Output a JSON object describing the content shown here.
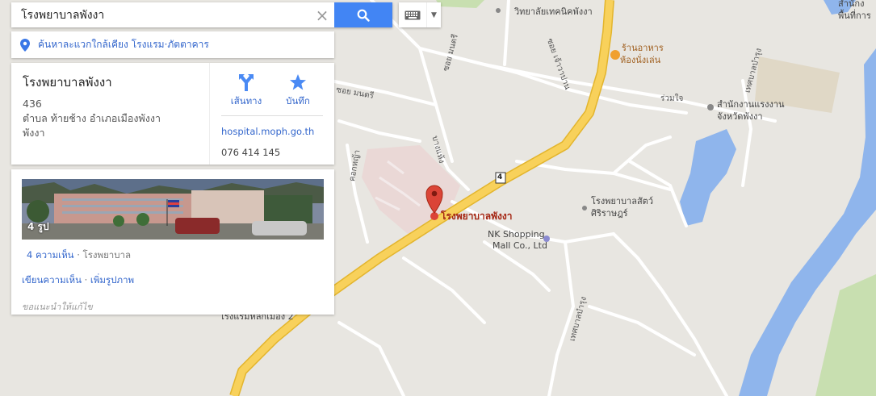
{
  "search": {
    "value": "โรงพยาบาลพังงา"
  },
  "nearby": {
    "text": "ค้นหาละแวกใกล้เคียง โรงแรม·ภัตตาคาร"
  },
  "place": {
    "name": "โรงพยาบาลพังงา",
    "address_line1": "436",
    "address_line2": "ตำบล ท้ายช้าง อำเภอเมืองพังงา",
    "address_line3": "พังงา",
    "directions_label": "เส้นทาง",
    "save_label": "บันทึก",
    "website": "hospital.moph.go.th",
    "phone": "076 414 145"
  },
  "details": {
    "photo_count": "4 รูป",
    "reviews_link": "4 ความเห็น",
    "category": "· โรงพยาบาล",
    "write_review": "เขียนความเห็น",
    "separator": "·",
    "add_photo": "เพิ่มรูปภาพ",
    "suggest_edit": "ขอแนะนำให้แก้ไข"
  },
  "map": {
    "marker_label": "โรงพยาบาลพังงา",
    "route_shield": "4",
    "labels": {
      "college": "วิทยาลัยเทคนิคพังงา",
      "restaurant_l1": "ร้านอาหาร",
      "restaurant_l2": "ห้องนั่งเล่น",
      "office_l1": "สำนักงานแรงงาน",
      "office_l2": "จังหวัดพังงา",
      "vet_l1": "โรงพยาบาลสัตว์",
      "vet_l2": "ศิริราษฎร์",
      "mall_l1": "NK Shopping",
      "mall_l2": "Mall Co., Ltd",
      "hotel": "โรงแรมหลักเมือง 2",
      "corner_l1": "สำนักง",
      "corner_l2": "พื้นที่การ"
    },
    "roads": {
      "soi_montri1": "ซอย มนตรี",
      "soi_montri2": "ซอย มนตรี",
      "soi_kwan": "ซอย เจ้าวาปาน",
      "ruam_jai": "ร่วมใจ",
      "bang_hang": "บางแห้ง",
      "khok_nua": "คอกหญ้า",
      "thepaburung1": "เทศบาลบำรุง",
      "thepaburung2": "เทศบาลบำรุง"
    }
  },
  "colors": {
    "map_bg": "#e8e6e1",
    "highway": "#f8d15b",
    "water": "#8fb5ec",
    "hospital_area": "#ead8d6",
    "accent_blue": "#4285f4",
    "link": "#3366cc",
    "marker": "#db4437"
  }
}
